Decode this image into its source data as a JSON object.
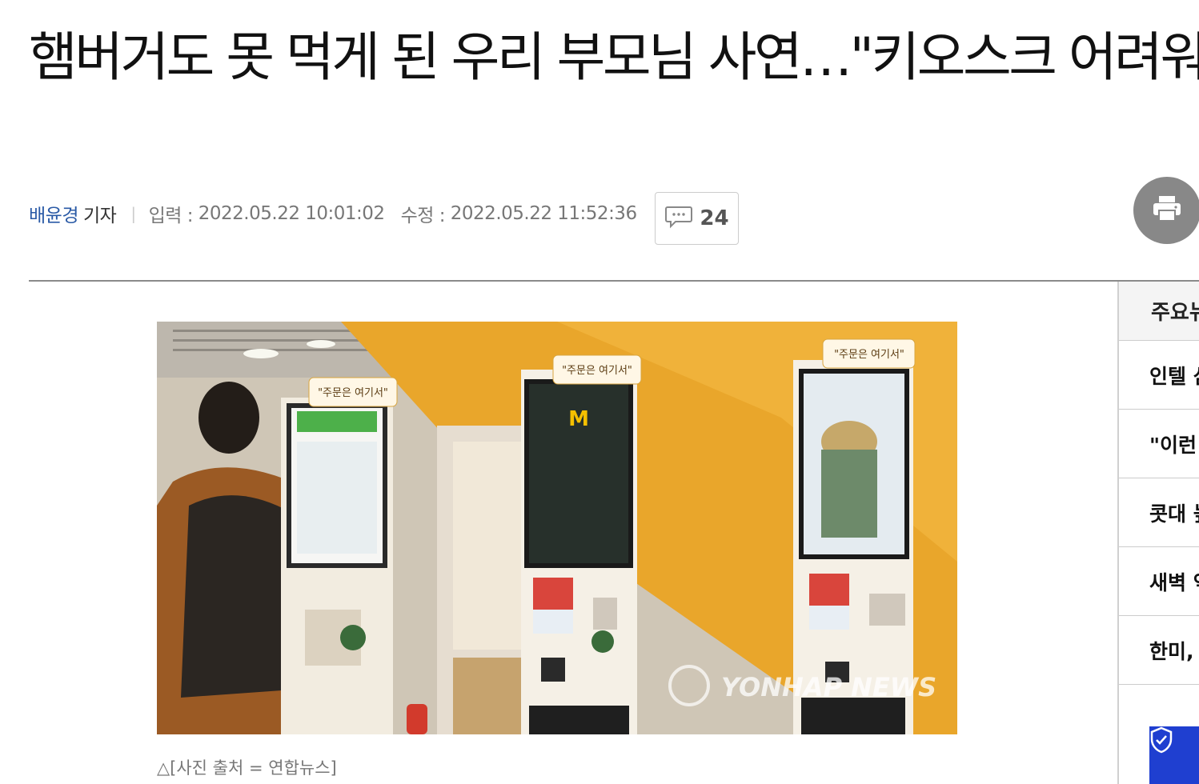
{
  "article": {
    "headline": "햄버거도 못 먹게 된 우리 부모님 사연…\"키오스크 어려워\"",
    "reporter_name": "배윤경",
    "reporter_title": "기자",
    "separator": "|",
    "input_label": "입력 :",
    "input_time": "2022.05.22 10:01:02",
    "modified_label": "수정 :",
    "modified_time": "2022.05.22 11:52:36",
    "comment_count": "24",
    "caption": "△[사진 출처 = 연합뉴스]"
  },
  "photo": {
    "kiosk_sign": "\"주문은 여기서\"",
    "watermark": "YONHAP NEWS"
  },
  "sidebar": {
    "header": "주요뉴스",
    "items": [
      {
        "label": "인텔 삼"
      },
      {
        "label": "\"이런"
      },
      {
        "label": "콧대 높"
      },
      {
        "label": "새벽 억"
      },
      {
        "label": "한미,"
      }
    ]
  },
  "colors": {
    "reporter_link": "#2a5aa6",
    "print_button": "#888888",
    "ad_blue": "#1f3fd0"
  },
  "icons": {
    "comment": "comment-bubble-icon",
    "print": "printer-icon"
  }
}
